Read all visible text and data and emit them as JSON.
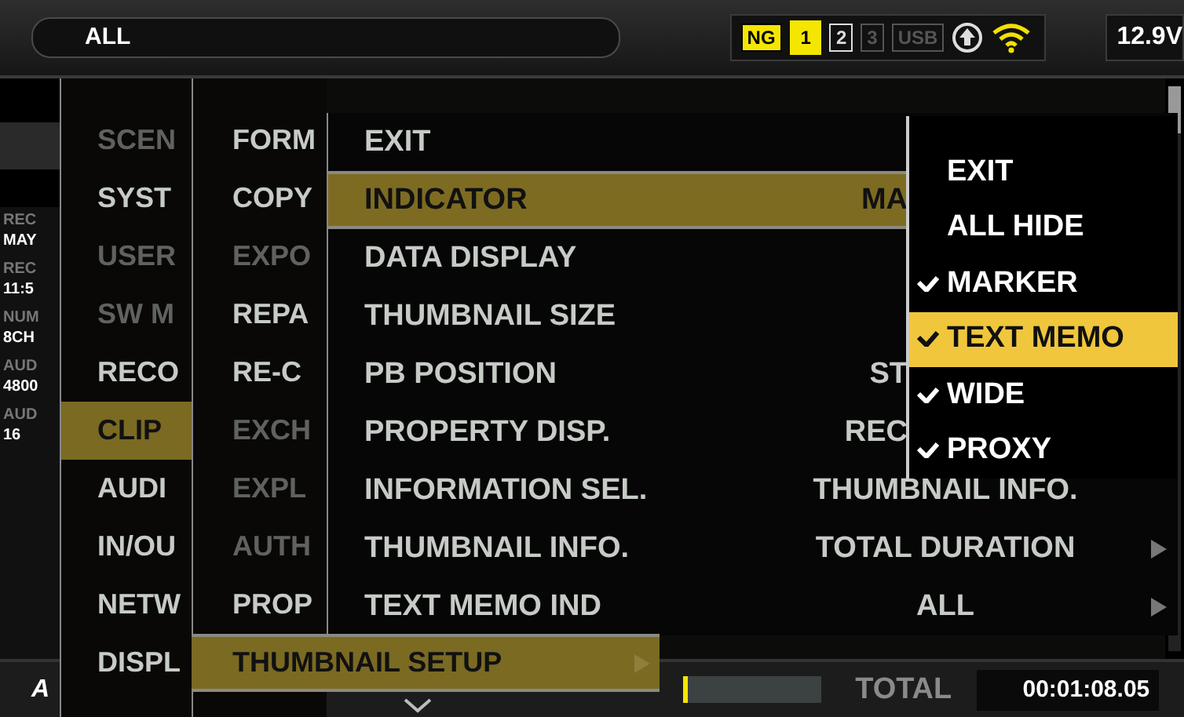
{
  "top_bar": {
    "filter": "ALL",
    "indicators": [
      {
        "label": "NG",
        "kind": "warning"
      },
      {
        "label": "1",
        "kind": "active"
      },
      {
        "label": "2",
        "kind": "ready"
      },
      {
        "label": "3",
        "kind": "inactive"
      },
      {
        "label": "USB",
        "kind": "inactive"
      }
    ],
    "voltage": "12.9V"
  },
  "info_panel": [
    {
      "label": "REC",
      "value": "MAY"
    },
    {
      "label": "REC",
      "value": "11:5"
    },
    {
      "label": "NUM",
      "value": "8CH"
    },
    {
      "label": "AUD",
      "value": "4800"
    },
    {
      "label": "AUD",
      "value": "16"
    }
  ],
  "main_menu": {
    "items": [
      {
        "label": "SCEN",
        "selected": false,
        "disabled": true
      },
      {
        "label": "SYST",
        "selected": false,
        "disabled": false
      },
      {
        "label": "USER",
        "selected": false,
        "disabled": true
      },
      {
        "label": "SW M",
        "selected": false,
        "disabled": true
      },
      {
        "label": "RECO",
        "selected": false,
        "disabled": false
      },
      {
        "label": "CLIP",
        "selected": true,
        "disabled": false
      },
      {
        "label": "AUDI",
        "selected": false,
        "disabled": false
      },
      {
        "label": "IN/OU",
        "selected": false,
        "disabled": false
      },
      {
        "label": "NETW",
        "selected": false,
        "disabled": false
      },
      {
        "label": "DISPL",
        "selected": false,
        "disabled": false
      }
    ]
  },
  "clip_menu": {
    "items": [
      {
        "label": "FORM",
        "selected": false,
        "disabled": false,
        "has_submenu": false
      },
      {
        "label": "COPY",
        "selected": false,
        "disabled": false,
        "has_submenu": false
      },
      {
        "label": "EXPO",
        "selected": false,
        "disabled": true,
        "has_submenu": false
      },
      {
        "label": "REPA",
        "selected": false,
        "disabled": false,
        "has_submenu": false
      },
      {
        "label": "RE-C",
        "selected": false,
        "disabled": false,
        "has_submenu": false
      },
      {
        "label": "EXCH",
        "selected": false,
        "disabled": true,
        "has_submenu": false
      },
      {
        "label": "EXPL",
        "selected": false,
        "disabled": true,
        "has_submenu": false
      },
      {
        "label": "AUTH",
        "selected": false,
        "disabled": true,
        "has_submenu": false
      },
      {
        "label": "PROP",
        "selected": false,
        "disabled": false,
        "has_submenu": false
      },
      {
        "label": "THUMBNAIL SETUP",
        "selected": true,
        "disabled": false,
        "has_submenu": true
      }
    ]
  },
  "thumbnail_setup_menu": {
    "items": [
      {
        "label": "EXIT",
        "selected": false,
        "has_submenu": false
      },
      {
        "label": "INDICATOR",
        "value": "MA",
        "selected": true,
        "has_submenu": false
      },
      {
        "label": "DATA DISPLAY",
        "selected": false,
        "has_submenu": false
      },
      {
        "label": "THUMBNAIL SIZE",
        "selected": false,
        "has_submenu": false
      },
      {
        "label": "PB POSITION",
        "value": "ST",
        "selected": false,
        "has_submenu": false
      },
      {
        "label": "PROPERTY DISP.",
        "value": "REC",
        "selected": false,
        "has_submenu": false
      },
      {
        "label": "INFORMATION SEL.",
        "value": "THUMBNAIL INFO.",
        "selected": false,
        "has_submenu": false
      },
      {
        "label": "THUMBNAIL INFO.",
        "value": "TOTAL DURATION",
        "selected": false,
        "has_submenu": true
      },
      {
        "label": "TEXT MEMO IND",
        "value": "ALL",
        "selected": false,
        "has_submenu": true
      }
    ]
  },
  "indicator_menu": {
    "items": [
      {
        "label": "EXIT",
        "checked": false,
        "selected": false
      },
      {
        "label": "ALL HIDE",
        "checked": false,
        "selected": false
      },
      {
        "label": "MARKER",
        "checked": true,
        "selected": false
      },
      {
        "label": "TEXT MEMO",
        "checked": true,
        "selected": true
      },
      {
        "label": "WIDE",
        "checked": true,
        "selected": false
      },
      {
        "label": "PROXY",
        "checked": true,
        "selected": false
      }
    ]
  },
  "bottom_bar": {
    "logo": "A",
    "progress": {
      "level": 0.05
    },
    "total_label": "TOTAL",
    "total_time": "00:01:08.05"
  }
}
